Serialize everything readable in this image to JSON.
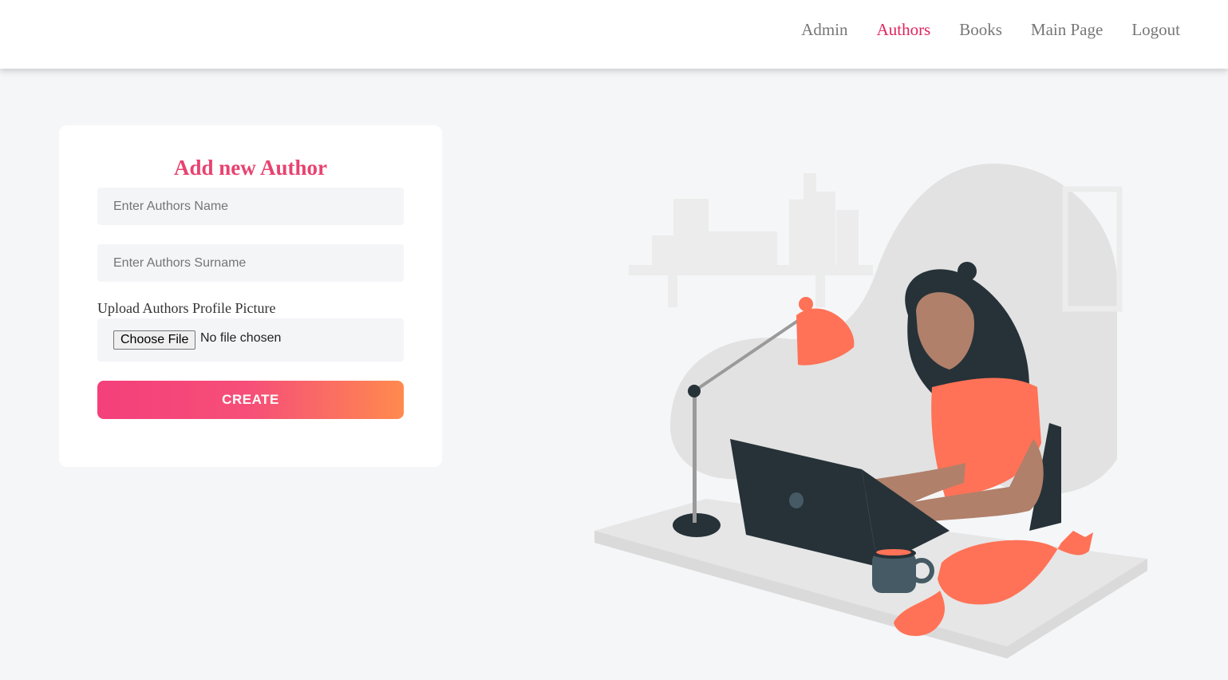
{
  "nav": {
    "items": [
      {
        "label": "Admin",
        "active": false
      },
      {
        "label": "Authors",
        "active": true
      },
      {
        "label": "Books",
        "active": false
      },
      {
        "label": "Main Page",
        "active": false
      },
      {
        "label": "Logout",
        "active": false
      }
    ]
  },
  "form": {
    "title": "Add new Author",
    "name_placeholder": "Enter Authors Name",
    "surname_placeholder": "Enter Authors Surname",
    "upload_label": "Upload Authors Profile Picture",
    "file_button_label": "Choose File",
    "file_status": "No file chosen",
    "submit_label": "CREATE"
  },
  "colors": {
    "accent": "#e0245e",
    "title": "#e8436f",
    "gradient_start": "#f43f7b",
    "gradient_end": "#ff8a4e",
    "illustration_primary": "#ff7257",
    "illustration_dark": "#263238"
  },
  "illustration": {
    "name": "woman-working-on-laptop-with-cat-illustration"
  }
}
